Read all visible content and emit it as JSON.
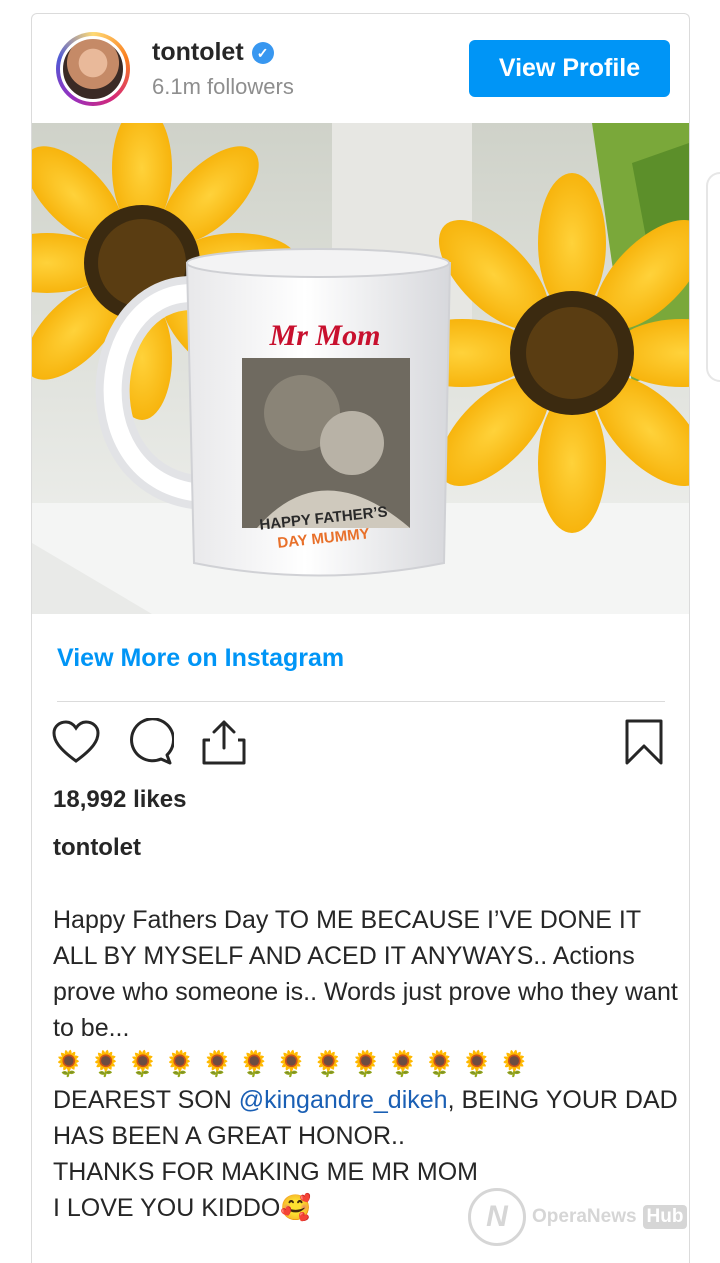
{
  "post": {
    "username": "tontolet",
    "followers": "6.1m followers",
    "view_profile_label": "View Profile",
    "view_more_label": "View More on Instagram",
    "likes": "18,992 likes",
    "caption_username": "tontolet",
    "caption_lines": [
      "Happy Fathers Day TO ME BECAUSE I’VE DONE IT ALL BY MYSELF AND ACED IT ANYWAYS.. Actions prove who someone is.. Words just prove who they want to be...",
      "🌻🌻🌻🌻🌻🌻🌻🌻🌻🌻🌻🌻🌻"
    ],
    "caption_son_prefix": "DEAREST SON ",
    "caption_mention": "@kingandre_dikeh",
    "caption_son_suffix": ", BEING YOUR DAD HAS BEEN A GREAT HONOR..",
    "caption_thanks": "THANKS FOR MAKING ME MR MOM",
    "caption_love": "I LOVE YOU KIDDO🥰"
  },
  "photo": {
    "mug_title": "Mr Mom",
    "mug_line1": "HAPPY FATHER’S",
    "mug_line2": "DAY MUMMY"
  },
  "watermark": {
    "logo_letter": "N",
    "brand": "OperaNews",
    "hub": "Hub"
  },
  "icons": [
    "heart-icon",
    "comment-icon",
    "share-icon",
    "bookmark-icon",
    "verified-badge-icon"
  ],
  "colors": {
    "accent": "#0095f6",
    "mug_title": "#c8102e",
    "mug_subtitle": "#e8702a"
  }
}
